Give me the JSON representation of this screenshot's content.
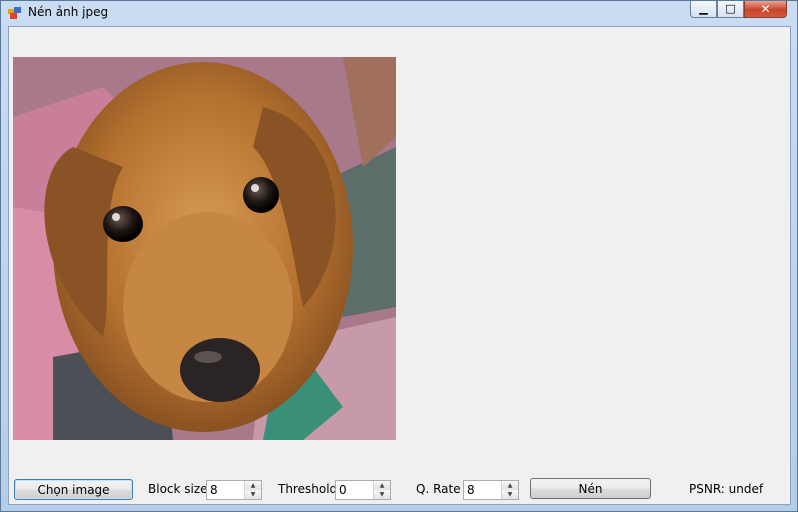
{
  "window": {
    "title": "Nén ảnh jpeg",
    "minimize_glyph": "▁",
    "maximize_glyph": "□",
    "close_glyph": "✕"
  },
  "image": {
    "description_icon": "dog-photo"
  },
  "controls": {
    "choose_button": "Chọn image",
    "block_size_label": "Block size",
    "block_size_value": "8",
    "threshold_label": "Threshold",
    "threshold_value": "0",
    "qrate_label": "Q. Rate",
    "qrate_value": "8",
    "compress_button": "Nén",
    "psnr_label": "PSNR: undef"
  },
  "colors": {
    "titlebar": "#c9dcf2",
    "client": "#f0f0f0",
    "close": "#c7442b"
  }
}
